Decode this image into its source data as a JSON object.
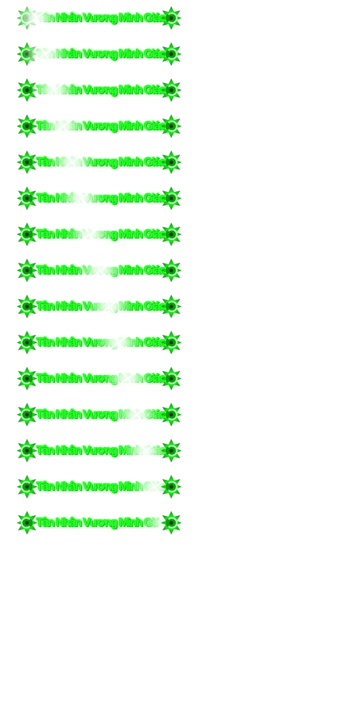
{
  "title_label": "Tân Nhân Vương Minh Giáo",
  "emblem_icon": "green-spiked-ring-icon",
  "colors": {
    "text": "#2cff2c",
    "glow": "#00ff00",
    "emblem": "#00e000",
    "shine": "#ffffff",
    "background": "#ffffff"
  },
  "frames": [
    {
      "shine_pct": 0
    },
    {
      "shine_pct": 7
    },
    {
      "shine_pct": 14
    },
    {
      "shine_pct": 21
    },
    {
      "shine_pct": 28
    },
    {
      "shine_pct": 35
    },
    {
      "shine_pct": 42
    },
    {
      "shine_pct": 50
    },
    {
      "shine_pct": 57
    },
    {
      "shine_pct": 64
    },
    {
      "shine_pct": 71
    },
    {
      "shine_pct": 78
    },
    {
      "shine_pct": 85
    },
    {
      "shine_pct": 92
    },
    {
      "shine_pct": 100
    }
  ]
}
